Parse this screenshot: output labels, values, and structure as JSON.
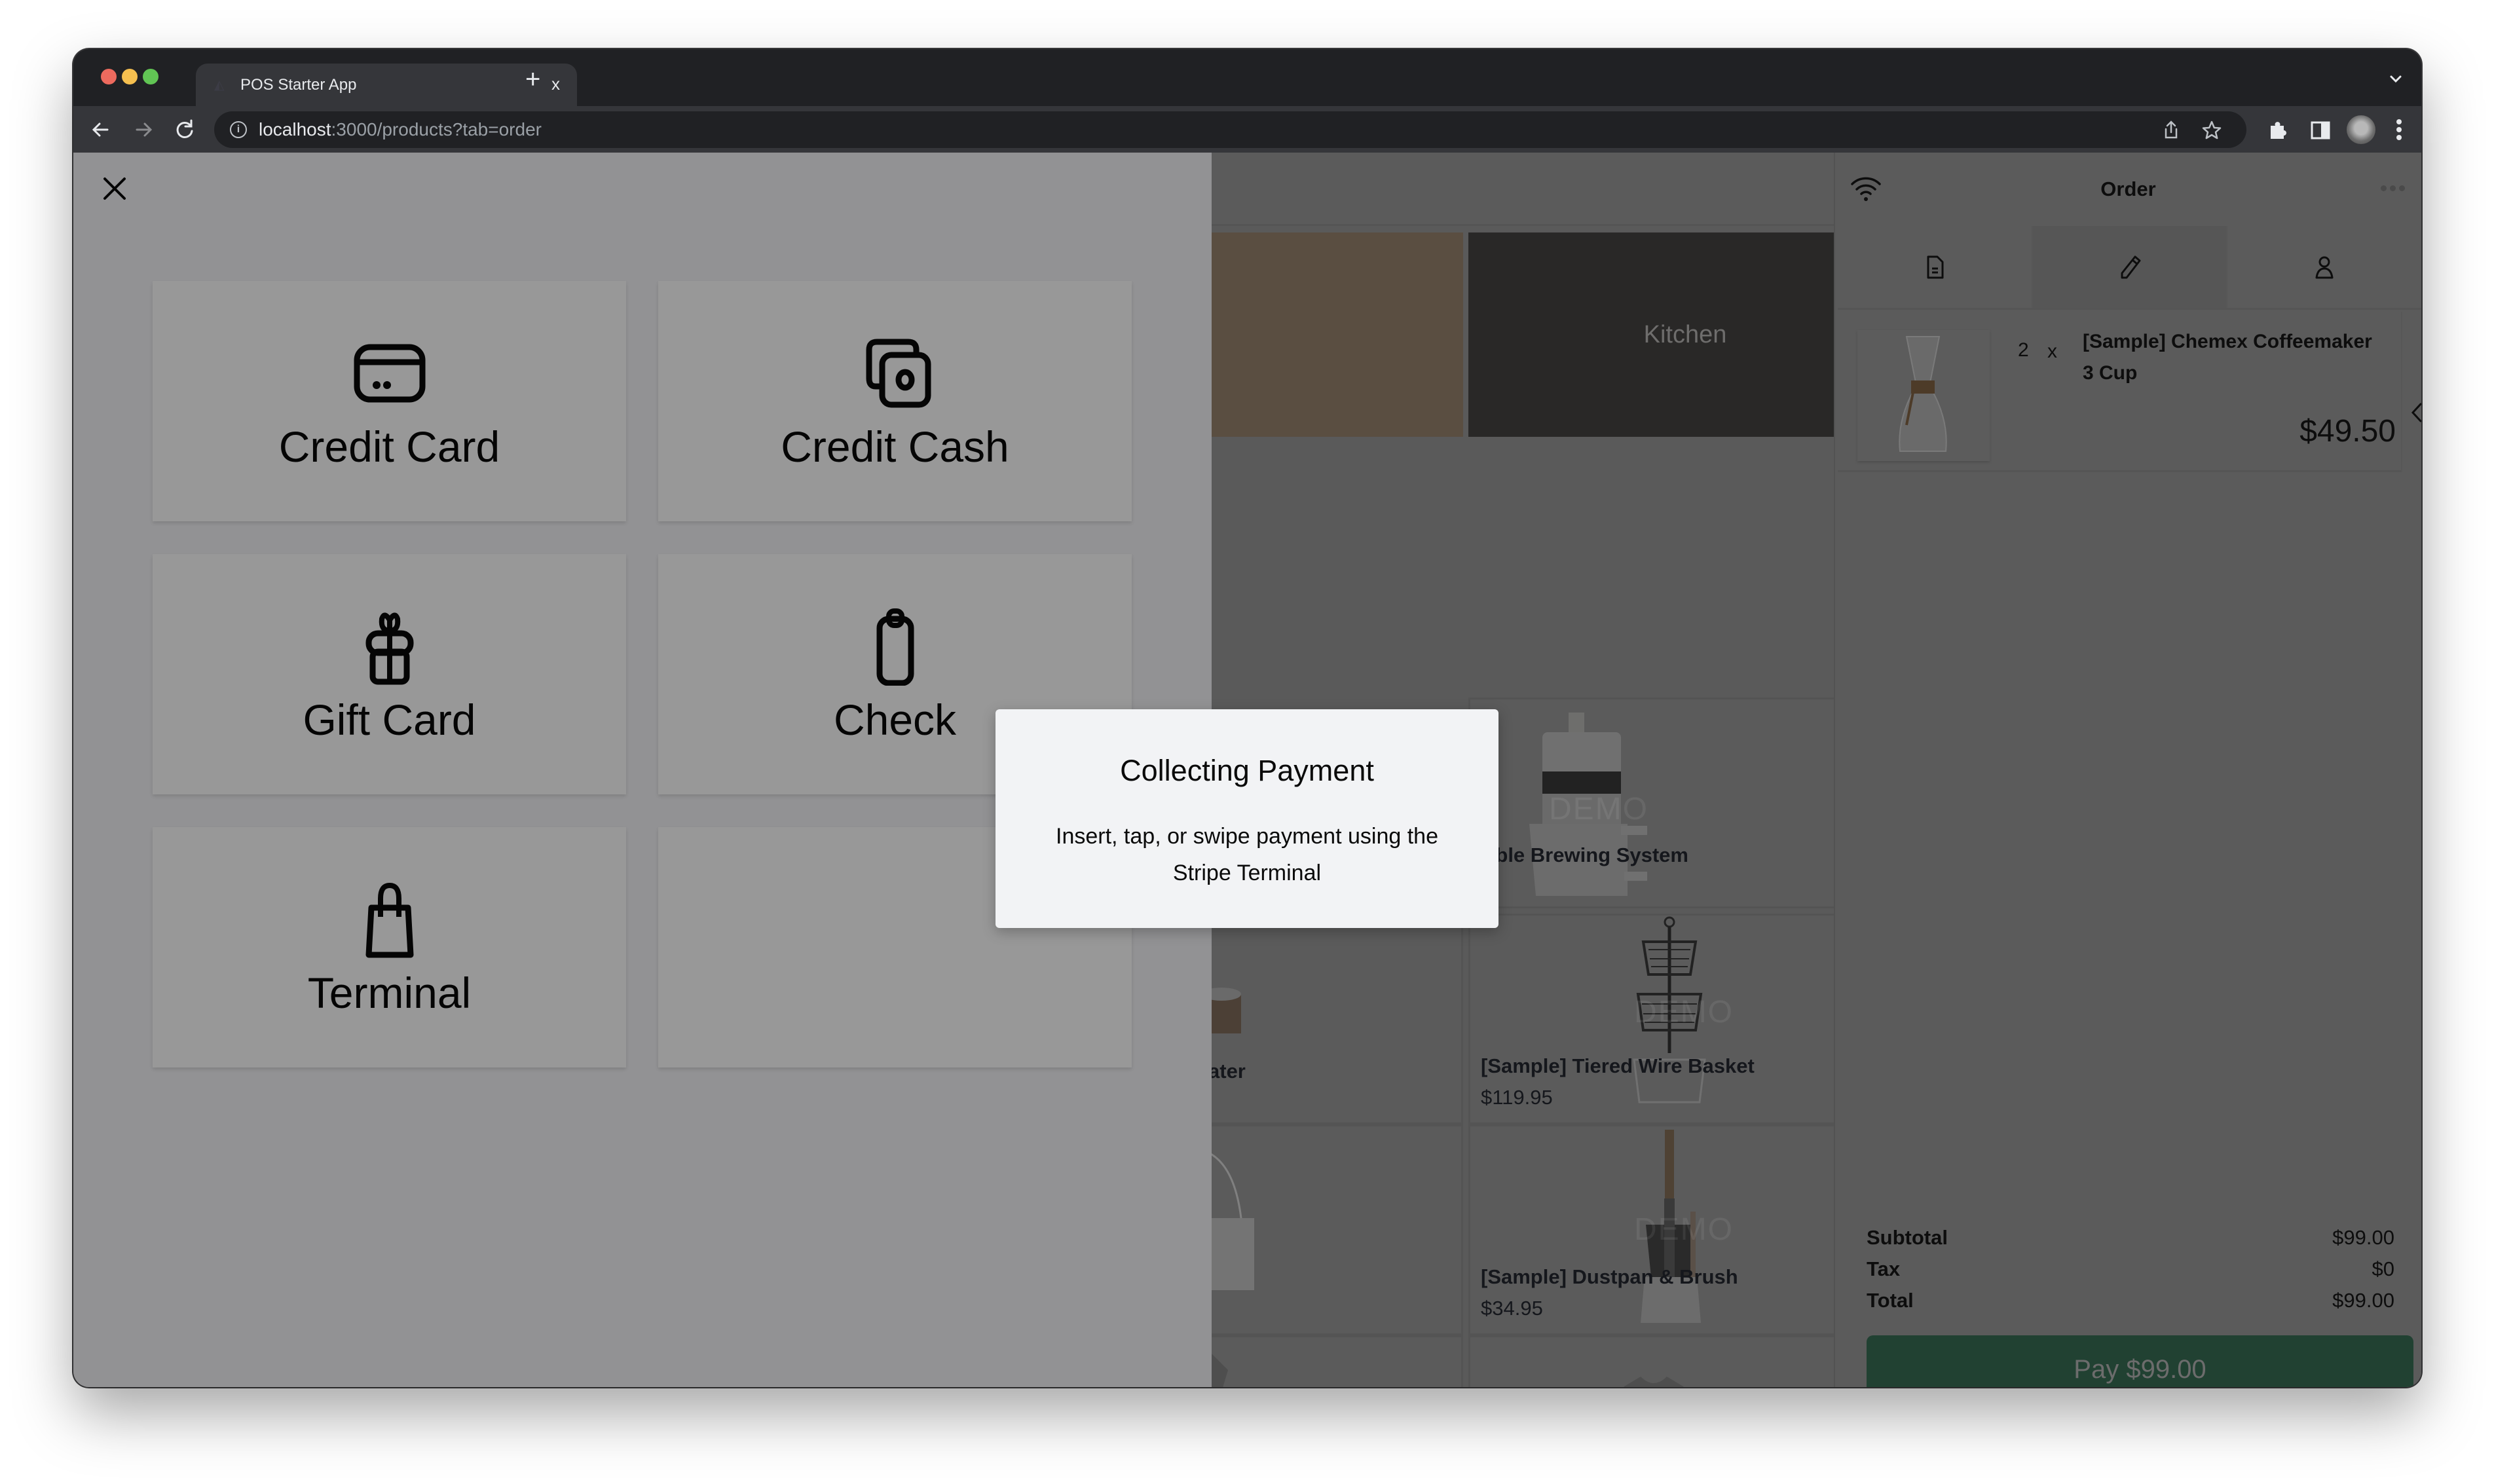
{
  "browser": {
    "tab_title": "POS Starter App",
    "tab_close": "x",
    "new_tab": "+",
    "url_host": "localhost",
    "url_rest": ":3000/products?tab=order"
  },
  "payment_panel": {
    "methods": [
      {
        "label": "Credit Card",
        "icon": "credit-card-icon"
      },
      {
        "label": "Credit Cash",
        "icon": "cash-icon"
      },
      {
        "label": "Gift Card",
        "icon": "gift-icon"
      },
      {
        "label": "Check",
        "icon": "clipboard-icon"
      },
      {
        "label": "Terminal",
        "icon": "shopping-bag-icon"
      },
      {
        "label": "",
        "icon": ""
      }
    ]
  },
  "modal": {
    "title": "Collecting Payment",
    "body": "Insert, tap, or swipe payment using the Stripe Terminal"
  },
  "catalog": {
    "categories": [
      {
        "label": ""
      },
      {
        "label": "Kitchen"
      }
    ],
    "products": [
      {
        "name": "Able Brewing System",
        "price": ""
      },
      {
        "name": "ater",
        "price": ""
      },
      {
        "name": "[Sample] Tiered Wire Basket",
        "price": "$119.95"
      },
      {
        "name": "",
        "price": ""
      },
      {
        "name": "[Sample] Dustpan & Brush",
        "price": "$34.95"
      }
    ],
    "watermark": "DEMO"
  },
  "order": {
    "title": "Order",
    "tabs": [
      {
        "icon": "document-icon"
      },
      {
        "icon": "pencil-icon"
      },
      {
        "icon": "user-icon"
      }
    ],
    "line_items": [
      {
        "qty": "2",
        "x": "x",
        "name": "[Sample] Chemex Coffeemaker 3 Cup",
        "price": "$49.50"
      }
    ],
    "totals": {
      "subtotal_label": "Subtotal",
      "subtotal": "$99.00",
      "tax_label": "Tax",
      "tax": "$0",
      "total_label": "Total",
      "total": "$99.00"
    },
    "pay_button": "Pay $99.00",
    "pay_color": "#214132"
  }
}
